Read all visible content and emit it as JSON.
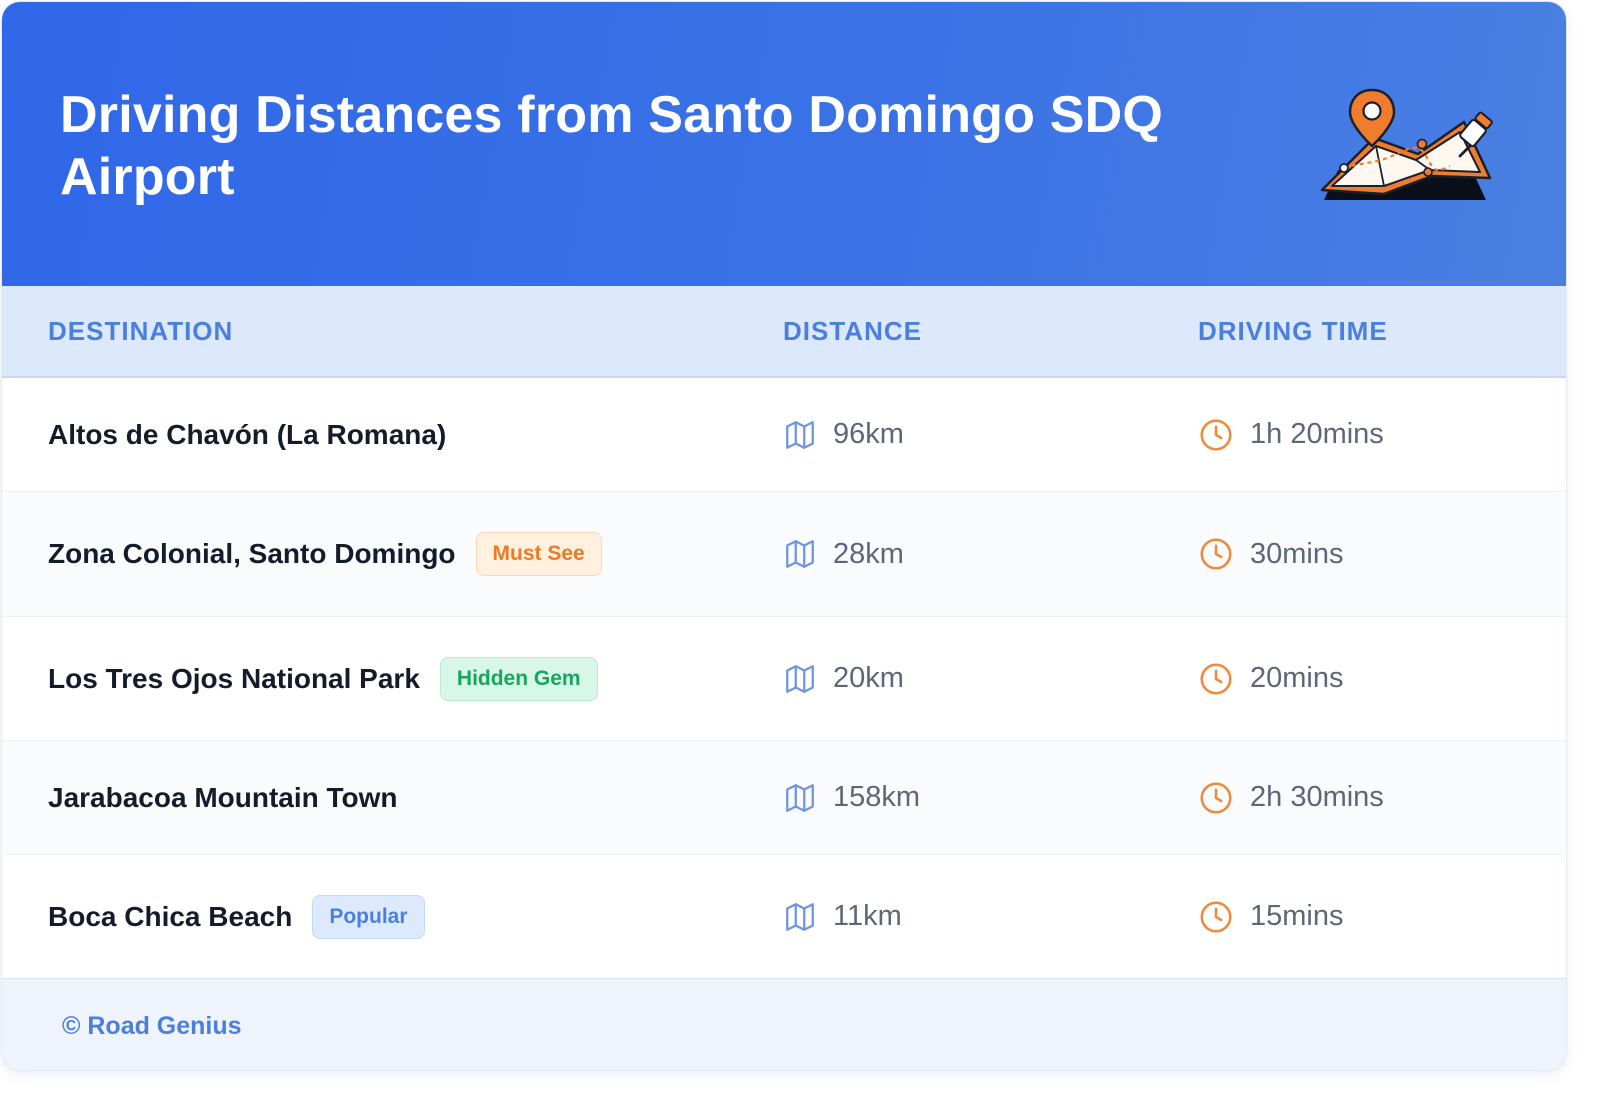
{
  "header": {
    "title": "Driving Distances from Santo Domingo SDQ Airport"
  },
  "table": {
    "columns": [
      "DESTINATION",
      "DISTANCE",
      "DRIVING TIME"
    ],
    "rows": [
      {
        "destination": "Altos de Chavón (La Romana)",
        "badge": "",
        "distance": "96km",
        "time": "1h 20mins"
      },
      {
        "destination": "Zona Colonial, Santo Domingo",
        "badge": "Must See",
        "distance": "28km",
        "time": "30mins"
      },
      {
        "destination": "Los Tres Ojos National Park",
        "badge": "Hidden Gem",
        "distance": "20km",
        "time": "20mins"
      },
      {
        "destination": "Jarabacoa Mountain Town",
        "badge": "",
        "distance": "158km",
        "time": "2h 30mins"
      },
      {
        "destination": "Boca Chica Beach",
        "badge": "Popular",
        "distance": "11km",
        "time": "15mins"
      }
    ]
  },
  "footer": {
    "text": "© Road Genius"
  },
  "icons": {
    "distance": "map-icon",
    "time": "clock-icon",
    "header": "map-pin-illustration"
  },
  "colors": {
    "header_gradient_start": "#2f67e8",
    "header_gradient_end": "#4a7fe2",
    "accent_blue": "#4a7fde",
    "clock_orange": "#ef8a3c",
    "badge_must_see": "#ee7a22",
    "badge_hidden_gem": "#17a562",
    "badge_popular": "#4b7fdd"
  }
}
